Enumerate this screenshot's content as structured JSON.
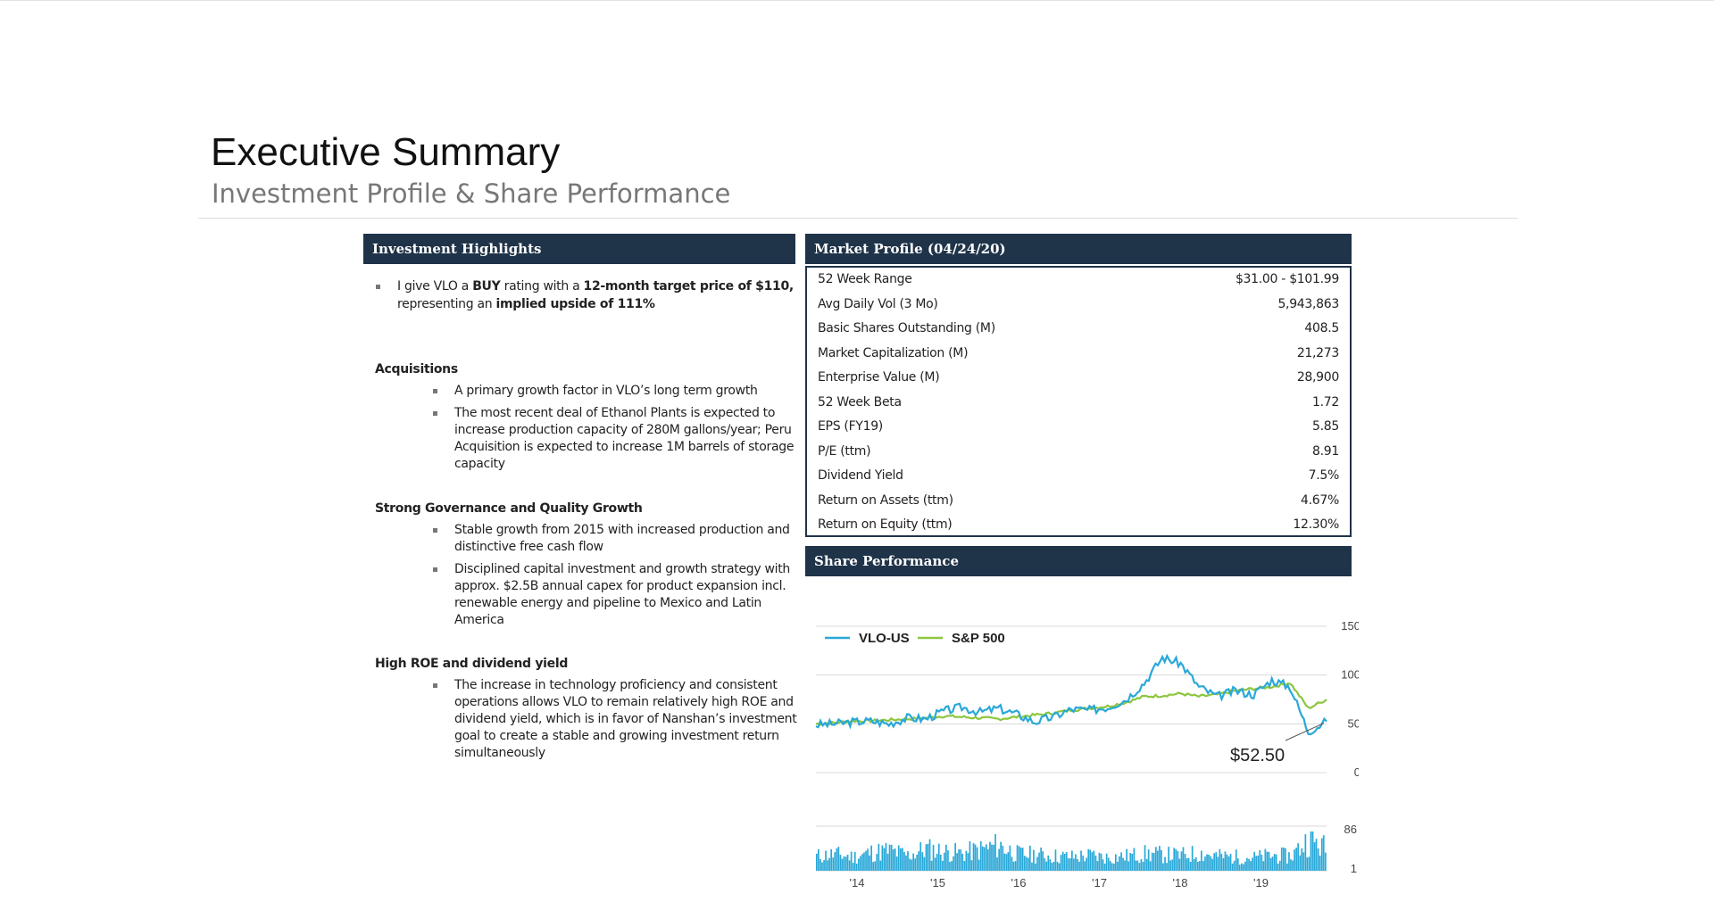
{
  "header": {
    "title": "Executive Summary",
    "subtitle": "Investment Profile & Share Performance"
  },
  "highlights": {
    "heading": "Investment Highlights",
    "intro": {
      "t1": "I give VLO a ",
      "b1": "BUY",
      "t2": " rating with a ",
      "b2": "12-month target price of $110,",
      "t3": "representing an ",
      "b3": "implied upside of 111%"
    },
    "sections": [
      {
        "title": "Acquisitions",
        "bullets": [
          [
            "A primary growth factor in VLO’s long term growth"
          ],
          [
            "The most recent deal of Ethanol Plants is expected to",
            "increase production capacity of 280M gallons/year; Peru",
            "Acquisition is expected to increase 1M barrels of storage",
            "capacity"
          ]
        ]
      },
      {
        "title": "Strong Governance and Quality Growth",
        "bullets": [
          [
            "Stable growth from 2015 with increased production and",
            "distinctive free cash flow"
          ],
          [
            "Disciplined capital investment and growth strategy with",
            "approx. $2.5B annual capex for product expansion incl.",
            "renewable energy and pipeline to Mexico and Latin",
            "America"
          ]
        ]
      },
      {
        "title": "High ROE and dividend yield",
        "bullets": [
          [
            "The increase in technology proficiency and consistent",
            "operations allows VLO to remain relatively high ROE and",
            "dividend yield, which is in favor of Nanshan’s investment",
            "goal to create a stable and growing investment return",
            "simultaneously"
          ]
        ]
      }
    ]
  },
  "market_profile": {
    "heading": "Market Profile (04/24/20)",
    "rows": [
      {
        "label": "52 Week Range",
        "value": "$31.00 - $101.99"
      },
      {
        "label": "Avg Daily Vol (3 Mo)",
        "value": "5,943,863"
      },
      {
        "label": "Basic Shares Outstanding (M)",
        "value": "408.5"
      },
      {
        "label": "Market Capitalization (M)",
        "value": "21,273"
      },
      {
        "label": "Enterprise Value (M)",
        "value": "28,900"
      },
      {
        "label": "52 Week Beta",
        "value": "1.72"
      },
      {
        "label": "EPS (FY19)",
        "value": "5.85"
      },
      {
        "label": "P/E (ttm)",
        "value": "8.91"
      },
      {
        "label": "Dividend Yield",
        "value": "7.5%"
      },
      {
        "label": "Return on Assets (ttm)",
        "value": "4.67%"
      },
      {
        "label": "Return on Equity (ttm)",
        "value": "12.30%"
      }
    ]
  },
  "share_performance": {
    "heading": "Share Performance"
  },
  "colors": {
    "header_bg": "#1f3349",
    "vlo": "#29a8d8",
    "sp500": "#8cc63f",
    "volume": "#29a8d8"
  },
  "chart_data": {
    "type": "line",
    "x": [
      "2013-07",
      "2013-10",
      "2014-01",
      "2014-04",
      "2014-07",
      "2014-10",
      "2015-01",
      "2015-04",
      "2015-07",
      "2015-10",
      "2016-01",
      "2016-04",
      "2016-07",
      "2016-10",
      "2017-01",
      "2017-04",
      "2017-07",
      "2017-10",
      "2018-01",
      "2018-04",
      "2018-07",
      "2018-10",
      "2019-01",
      "2019-04",
      "2019-07",
      "2019-10",
      "2020-01",
      "2020-03",
      "2020-04"
    ],
    "series": [
      {
        "name": "VLO-US",
        "values": [
          49,
          50,
          52,
          53,
          50,
          56,
          55,
          63,
          67,
          62,
          66,
          60,
          52,
          57,
          65,
          64,
          67,
          75,
          92,
          118,
          112,
          88,
          78,
          84,
          80,
          95,
          88,
          42,
          52.5
        ]
      },
      {
        "name": "S&P 500",
        "values": [
          50,
          51,
          53,
          53,
          54,
          55,
          56,
          58,
          57,
          56,
          55,
          57,
          59,
          61,
          64,
          66,
          68,
          72,
          78,
          79,
          81,
          78,
          80,
          84,
          86,
          88,
          92,
          66,
          75
        ]
      }
    ],
    "volume": [
      40,
      45,
      38,
      50,
      55,
      42,
      60,
      52,
      48,
      58,
      70,
      46,
      44,
      40,
      38,
      42,
      36,
      40,
      46,
      44,
      42,
      48,
      40,
      38,
      36,
      42,
      40,
      86,
      60
    ],
    "callout": "$52.50",
    "ylim": [
      0,
      150
    ],
    "yticks": [
      "150",
      "100",
      "50",
      "0"
    ],
    "volume_ticks": [
      "86",
      "1"
    ],
    "xticks": [
      "'14",
      "'15",
      "'16",
      "'17",
      "'18",
      "'19"
    ],
    "legend": "top-left"
  }
}
